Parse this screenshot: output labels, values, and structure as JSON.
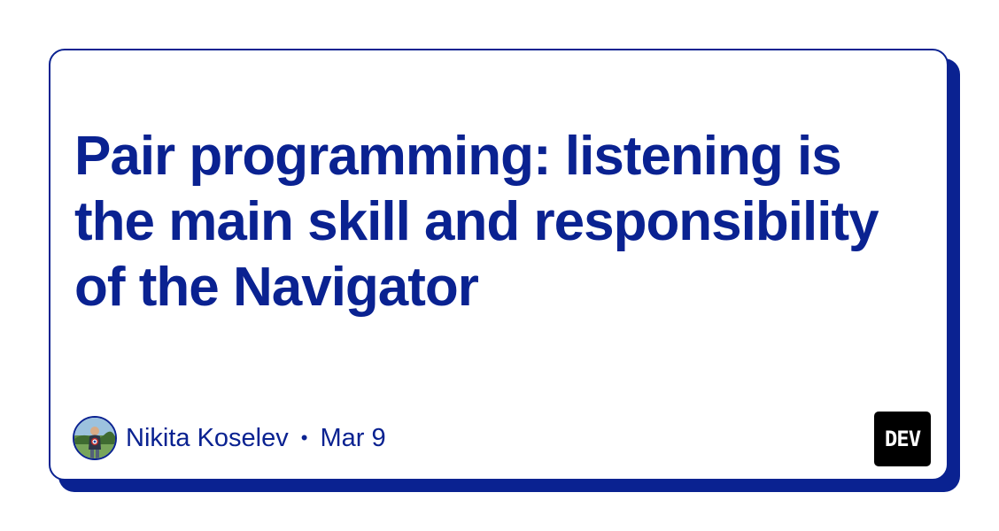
{
  "card": {
    "title": "Pair programming: listening is the main skill and responsibility of the Navigator",
    "author_name": "Nikita Koselev",
    "separator": "•",
    "date": "Mar 9",
    "logo_text": "DEV"
  },
  "colors": {
    "accent": "#0a2291",
    "background": "#ffffff",
    "logo_background": "#000000"
  },
  "icons": {
    "avatar": "author-avatar-photo",
    "logo": "dev-logo"
  }
}
